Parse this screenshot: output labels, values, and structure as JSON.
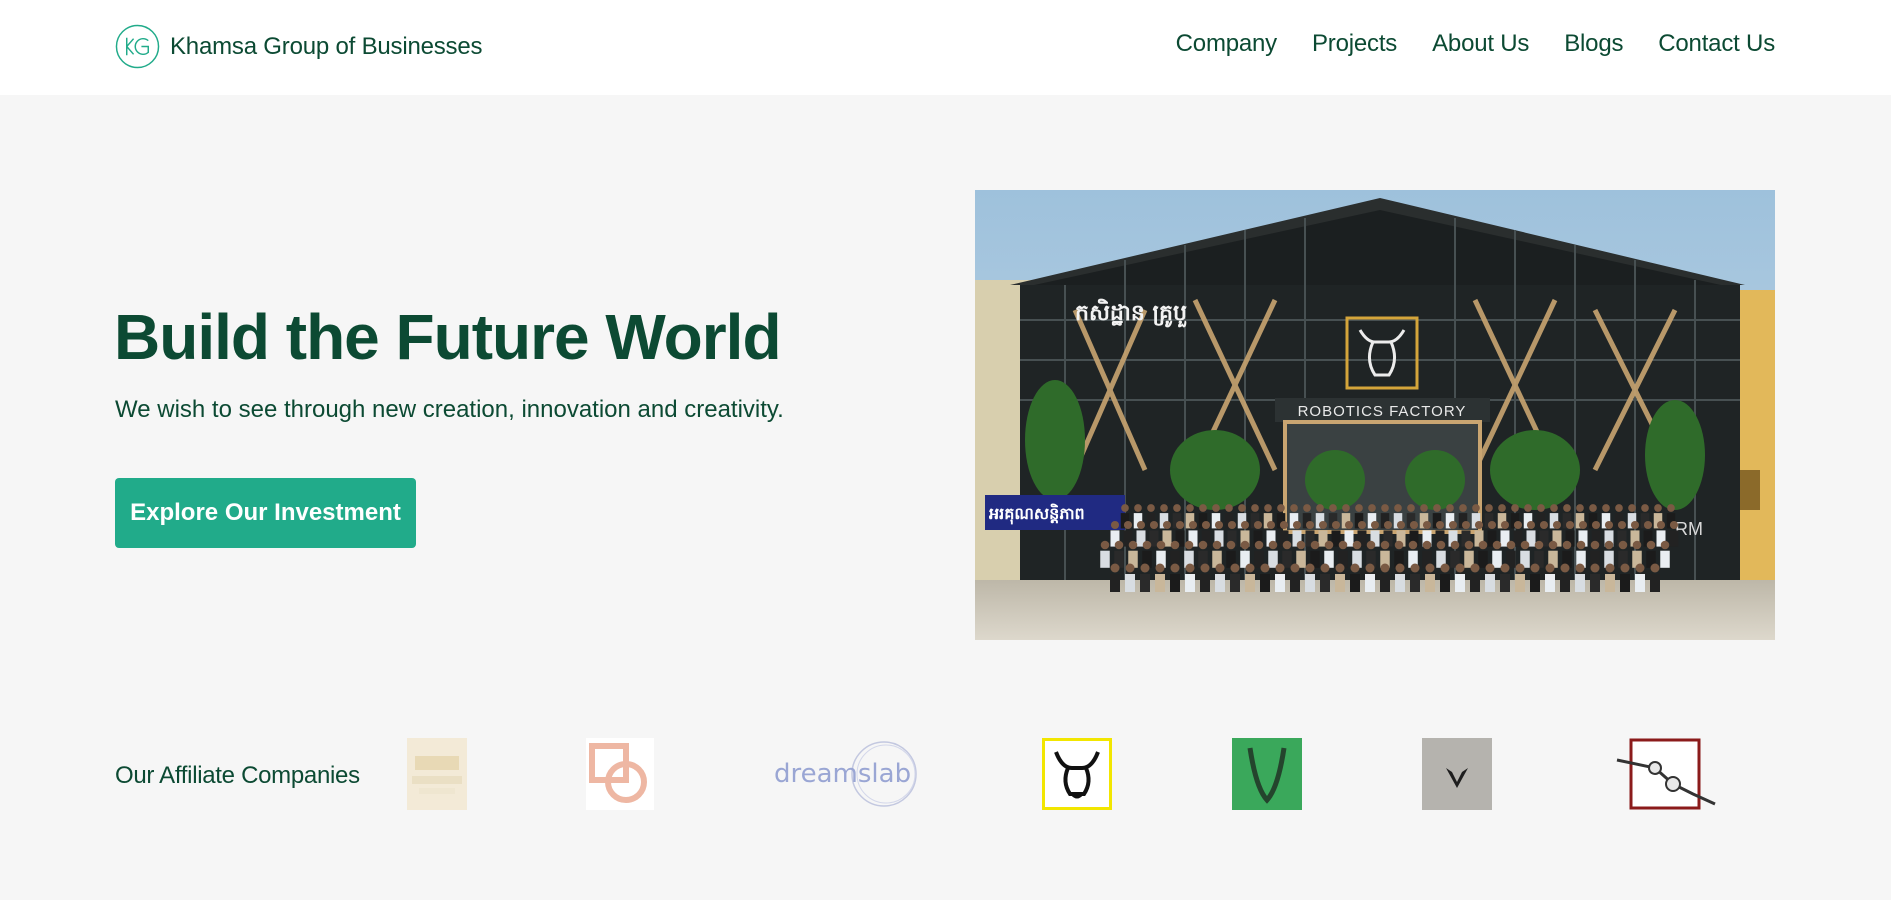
{
  "header": {
    "brand_name": "Khamsa Group of Businesses",
    "logo_icon": "kg-circle-logo-icon",
    "nav": [
      {
        "label": "Company"
      },
      {
        "label": "Projects"
      },
      {
        "label": "About Us"
      },
      {
        "label": "Blogs"
      },
      {
        "label": "Contact Us"
      }
    ]
  },
  "hero": {
    "title": "Build the Future World",
    "subtitle": "We wish to see through new creation, innovation and creativity.",
    "cta_label": "Explore Our Investment",
    "photo": {
      "sign_khmer": "កសិដ្ឋាន គ្រូបួ",
      "sign_factory": "ROBOTICS FACTORY",
      "banner_khmer": "អរគុណសន្តិភាព",
      "sign_right": "RM"
    }
  },
  "affiliates": {
    "label": "Our Affiliate Companies",
    "logos": [
      {
        "icon": "faded-gold-logo-icon"
      },
      {
        "icon": "overlapping-square-circle-logo-icon"
      },
      {
        "icon": "dreamslab-logo-icon",
        "text": "dreamslab"
      },
      {
        "icon": "bull-head-logo-icon"
      },
      {
        "icon": "green-v-logo-icon"
      },
      {
        "icon": "silver-v-logo-icon"
      },
      {
        "icon": "robotic-arm-logo-icon"
      }
    ]
  },
  "colors": {
    "brand_dark_green": "#0c4a33",
    "accent_teal": "#21ab8a",
    "page_background": "#f6f6f6",
    "header_background": "#ffffff"
  }
}
